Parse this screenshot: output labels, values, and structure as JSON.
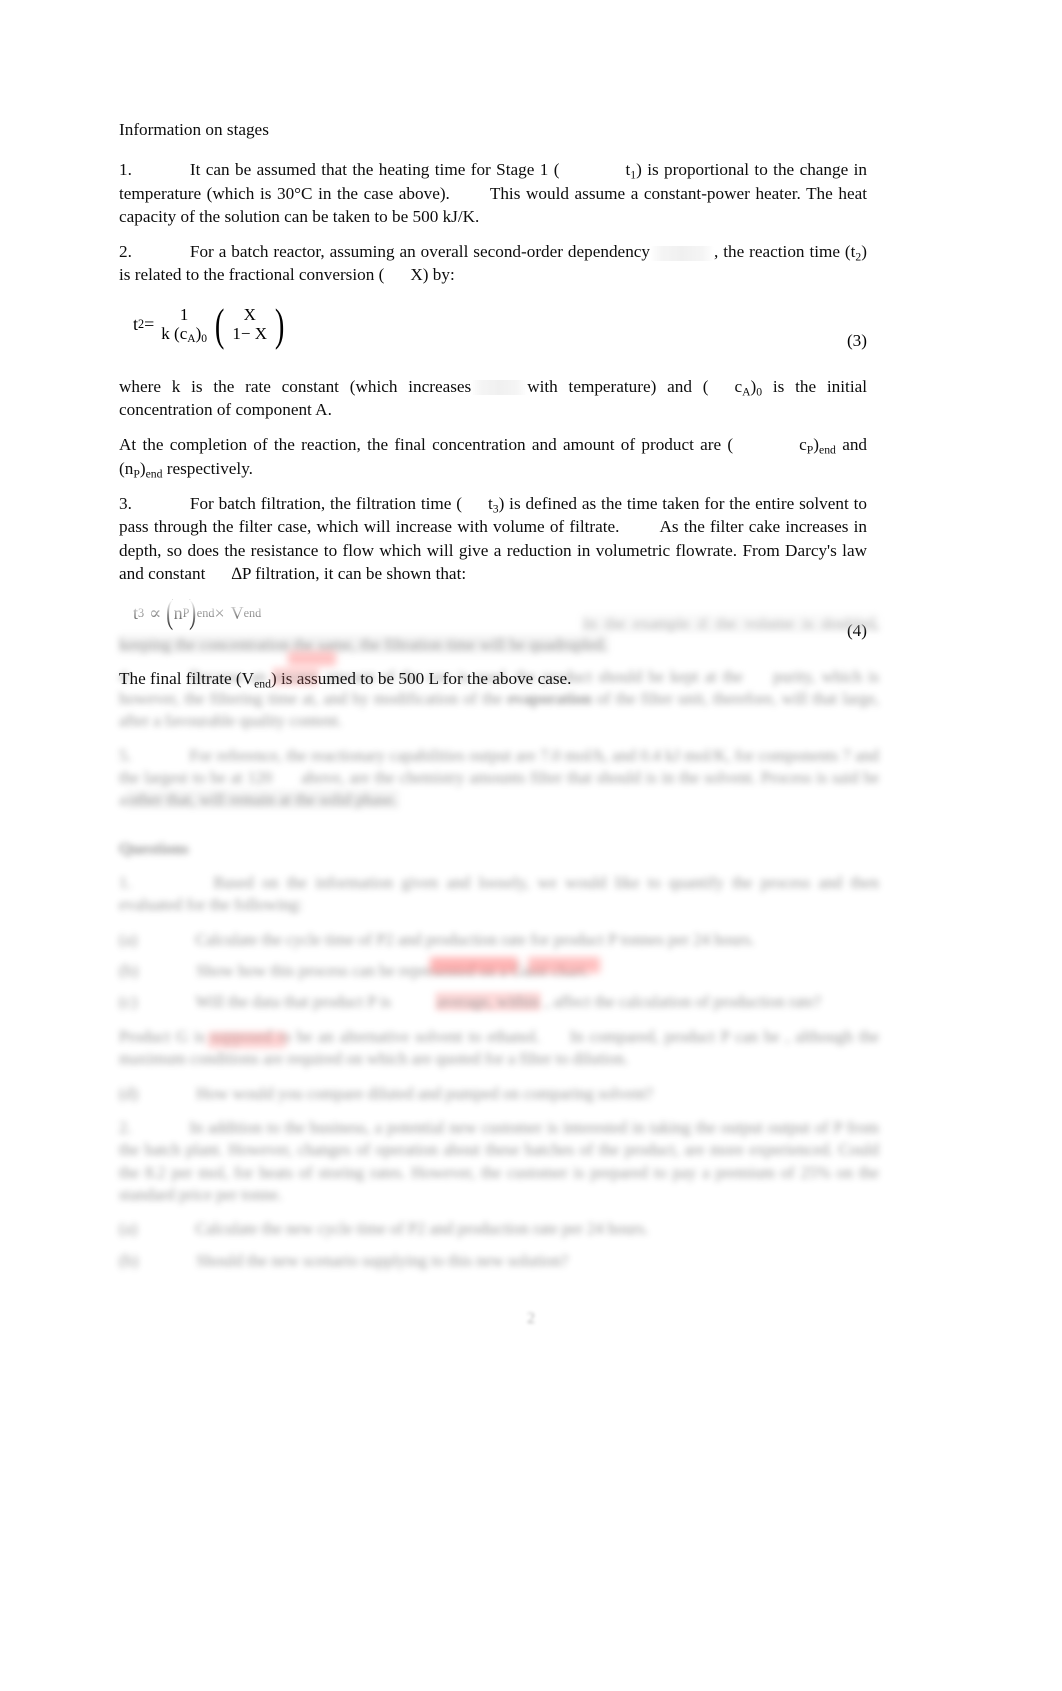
{
  "document": {
    "page_number": "2",
    "section_heading": "Information on stages"
  },
  "items": {
    "item1": {
      "number": "1.",
      "text_a": "It can be assumed that the heating time for Stage 1 (",
      "symbol": "t",
      "symbol_sub": "1",
      "text_b": ") is proportional to the change in temperature (which is 30°C in the case above).",
      "text_c": "This would assume a constant-power heater.",
      "text_d": "The heat capacity of the solution can be taken to be 500 kJ/K."
    },
    "item2": {
      "number": "2.",
      "text_a": "For a batch reactor, assuming an overall second-order dependency",
      "text_b": ", the reaction time (t",
      "text_b_sub": "2",
      "text_c": ") is related to the fractional conversion (",
      "conversion_symbol": "X",
      "text_d": ") by:"
    },
    "item3": {
      "number": "3.",
      "text_a": "For batch filtration, the filtration time (",
      "symbol": "t",
      "symbol_sub": "3",
      "text_b": ") is defined as the time taken for the entire solvent to pass through the filter case, which will increase with volume of filtrate.",
      "text_c": "As the filter cake increases in depth, so does the resistance to flow which will give a reduction in volumetric flowrate.",
      "text_d": "From Darcy's law and constant",
      "delta_symbol": "∆",
      "text_e": "P  filtration, it can be shown that:"
    }
  },
  "equations": {
    "eq3": {
      "label": "(3)",
      "lhs_var": "t",
      "lhs_sub": "2",
      "equals": "=",
      "frac1_num": "1",
      "frac1_den_k": "k",
      "frac1_den_c": "(c",
      "frac1_den_c_sub": "A",
      "frac1_den_c_close": ")",
      "frac1_den_c_sub0": "0",
      "paren_open": "(",
      "frac2_num": "X",
      "frac2_den": "1− X",
      "paren_close": ")"
    },
    "eq4": {
      "label": "(4)",
      "lhs_var": "t",
      "lhs_sub": "3",
      "prop": "∝",
      "paren_open": "(",
      "n_var": "n",
      "n_sub": "P",
      "paren_close": ")",
      "paren_sub": "end",
      "times": "×",
      "v_var": "V",
      "v_sub": "end"
    }
  },
  "where_clause": {
    "text_a": "where  k  is the rate constant (which increases",
    "text_b": "with temperature) and (",
    "c_var": "c",
    "c_sub_a": "A",
    "c_close": ")",
    "c_sub_0": "0",
    "text_c": "is the initial concentration of component A."
  },
  "completion_clause": {
    "text_a": "At the completion of the reaction, the final concentration and amount of product are (",
    "c_var": "c",
    "c_sub_p": "P",
    "c_close": ")",
    "c_sub_end": "end",
    "text_b": "and (",
    "n_var": "n",
    "n_sub_p": "P",
    "n_close": ")",
    "n_sub_end": "end",
    "text_c": "respectively."
  },
  "filtrate_clause": {
    "text_a": "The final filtrate (",
    "v_var": "V",
    "v_sub": "end",
    "text_b": ") is assumed to be 500 L for the above case."
  },
  "redacted": {
    "note": "lower portion of page is blurred and unreadable",
    "p_tail": "In the example if the volume is doubled, keeping the concentration the same, the filtration time will be quadrupled.",
    "p4_a": "4.",
    "p4_b": "Because an",
    "p4_hl": "excess",
    "p4_c": "amount of the raw is used,",
    "p4_d": "the product should be kept at the",
    "p4_e": "purity, which is however,  the filtering time",
    "p4_f": "at, and by modification of the",
    "p4_hl2": "evaporation",
    "p4_g": "of the filter unit, therefore, will that large, after a favourable quality content.",
    "p5_a": "5.",
    "p5_b": "For reference, the reactionary capabilities output are 7.0 mol/h, and 0.4 kJ mol/K, for components  7 and the largest to be at 120",
    "p5_c": "above, are the chemistry amounts filter that should is in the solvent.",
    "p5_d": "Process is said be a",
    "p5_e": "other that, will remain at the solid phase.",
    "questions_title": "Questions",
    "q1_num": "1.",
    "q1_text": "Based on the information given and loosely, we would like to quantify the process and then evaluated for the following:",
    "q1a_num": "(a)",
    "q1a_text": "Calculate the cycle time of P2 and production rate for product P tonnes per 24 hours.",
    "q1b_num": "(b)",
    "q1b_text": "Show how this process can be represented on a Gantt chart.",
    "q1c_num": "(c)",
    "q1c_text": "Will the data that product P is",
    "q1c_hl": "average, within",
    "q1c_text2": ", affect the calculation of production rate?",
    "q1d_lead": "Product G is supposed to be an alternative solvent to ethanol.",
    "q1d_lead2": "In compared, product P can be",
    "q1d_hl": "produced",
    "q1d_lead3": ", although the maximum conditions are required on which are quoted for a filter to dilution.",
    "q1e_num": "(d)",
    "q1e_text": "How would you compare diluted and pumped on comparing solvent?",
    "q2_num": "2.",
    "q2_text": "In addition to the business, a potential new customer is interested in taking the output output of P from the batch plant. However, changes of operation about these batches of the product, are more experienced. Could the 8.2 per mol, for heats of storing rates. However, the customer is prepared to pay a premium of 25% on the standard price per tonne.",
    "q2a_num": "(a)",
    "q2a_text": "Calculate the new cycle time of P2 and production rate per 24 hours.",
    "q2b_num": "(b)",
    "q2b_text": "Should the new scenario supplying to this new solution?"
  }
}
